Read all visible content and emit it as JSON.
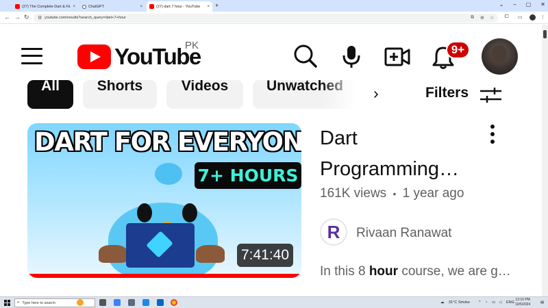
{
  "browser": {
    "tabs": [
      {
        "title": "(27) The Complete Dart & Flutt",
        "close": "×"
      },
      {
        "title": "ChatGPT",
        "close": "×"
      },
      {
        "title": "(27) dart 7 hour - YouTube",
        "close": "×"
      }
    ],
    "new_tab": "+",
    "window_controls": [
      "⌄",
      "–",
      "▢",
      "✕"
    ],
    "url": "youtube.com/results?search_query=dart+7+hour"
  },
  "youtube": {
    "logo_text": "YouTube",
    "country_code": "PK",
    "notification_count": "9+",
    "icons": [
      "menu-icon",
      "search-icon",
      "microphone-icon",
      "create-video-icon",
      "bell-icon",
      "chevron-right-icon",
      "filters-icon",
      "more-vert-icon"
    ]
  },
  "chips": {
    "items": [
      "All",
      "Shorts",
      "Videos",
      "Unwatched"
    ],
    "filters_label": "Filters"
  },
  "video": {
    "thumbnail_headline": "DART FOR EVERYONE",
    "thumbnail_badge": "7+ HOURS",
    "duration": "7:41:40",
    "title_line1": "Dart",
    "title_line2": "Programming…",
    "views": "161K views",
    "separator": "•",
    "age": "1 year ago",
    "channel_initial": "R",
    "channel_name": "Rivaan Ranawat",
    "desc_prefix": "In this 8 ",
    "desc_bold": "hour",
    "desc_suffix": " course, we are g…",
    "watch_progress": 1.0
  },
  "taskbar": {
    "search_placeholder": "Type here to search",
    "weather": "31°C  Smoke",
    "language": "ENG",
    "time": "12:10 PM",
    "date": "10/5/2024"
  },
  "colors": {
    "youtube_red": "#ff0000",
    "badge_red": "#cc0000",
    "chip_selected": "#0f0f0f",
    "chip_unselected": "#f2f2f2",
    "thumb_badge_text": "#3ff0d8"
  }
}
